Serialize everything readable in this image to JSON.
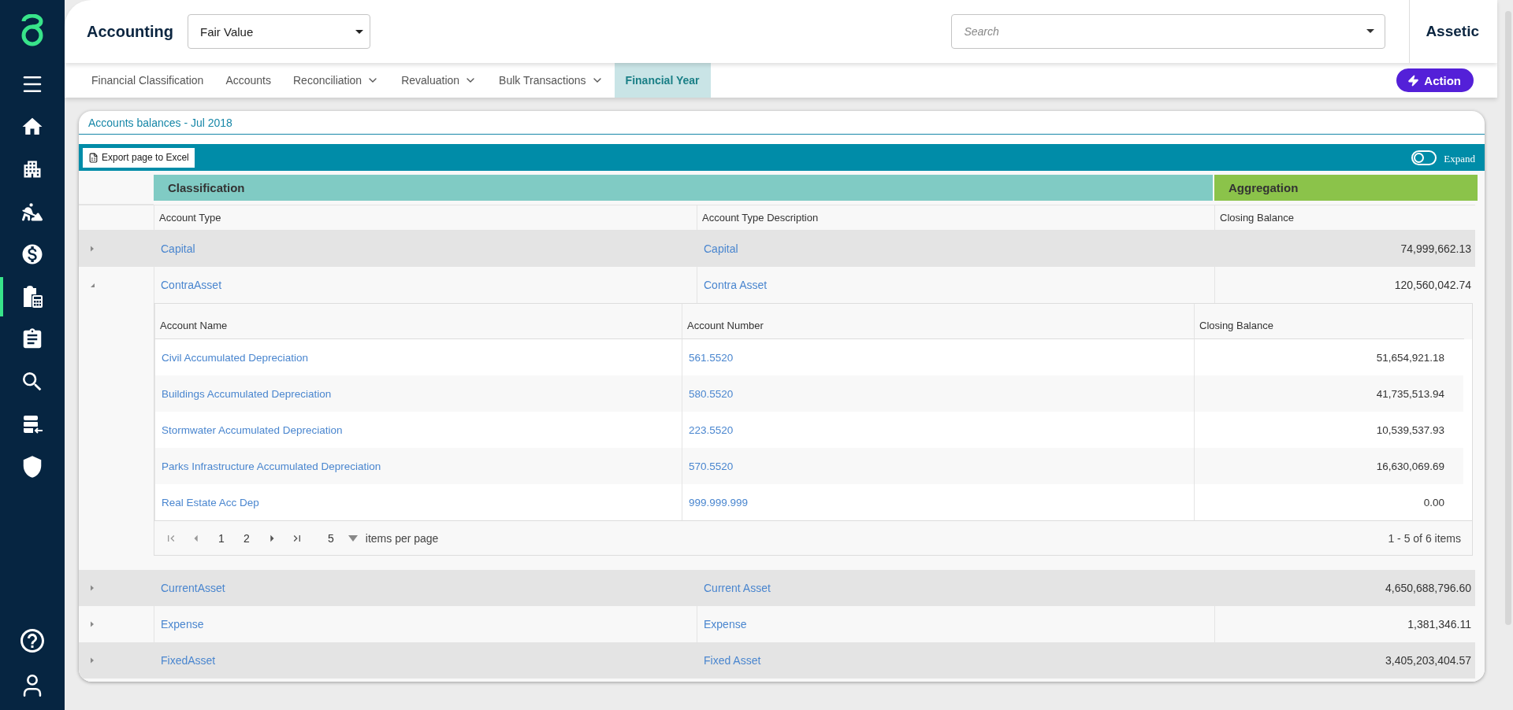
{
  "sidebar": {
    "items": [
      {
        "kind": "menu",
        "selected": false
      },
      {
        "kind": "home",
        "selected": false
      },
      {
        "kind": "building",
        "selected": false
      },
      {
        "kind": "worker",
        "selected": false
      },
      {
        "kind": "finance",
        "selected": false
      },
      {
        "kind": "calculator",
        "selected": true
      },
      {
        "kind": "clipboard",
        "selected": false
      },
      {
        "kind": "search",
        "selected": false
      },
      {
        "kind": "import",
        "selected": false
      },
      {
        "kind": "shield",
        "selected": false
      }
    ],
    "footer_items": [
      {
        "kind": "help"
      },
      {
        "kind": "user"
      }
    ]
  },
  "header": {
    "title": "Accounting",
    "view_select": {
      "value": "Fair Value"
    },
    "search": {
      "placeholder": "Search"
    },
    "brand": "Assetic"
  },
  "tabs": [
    {
      "label": "Financial Classification",
      "selected": false,
      "has_menu": false
    },
    {
      "label": "Accounts",
      "selected": false,
      "has_menu": false
    },
    {
      "label": "Reconciliation",
      "selected": false,
      "has_menu": true
    },
    {
      "label": "Revaluation",
      "selected": false,
      "has_menu": true
    },
    {
      "label": "Bulk Transactions",
      "selected": false,
      "has_menu": true
    },
    {
      "label": "Financial Year",
      "selected": true,
      "has_menu": false
    }
  ],
  "action_button": {
    "label": "Action"
  },
  "panel": {
    "title": "Accounts balances - Jul 2018",
    "export_button": "Export page to Excel",
    "expand_toggle": {
      "label": "Expand",
      "on": false
    },
    "column_groups": [
      {
        "label": "Classification",
        "color": "#80cbc4"
      },
      {
        "label": "Aggregation",
        "color": "#8bc34a"
      }
    ],
    "columns": [
      "Account Type",
      "Account Type Description",
      "Closing Balance"
    ],
    "rows": [
      {
        "account_type": "Capital",
        "description": "Capital",
        "closing_balance": "74,999,662.13",
        "expanded": false
      },
      {
        "account_type": "ContraAsset",
        "description": "Contra Asset",
        "closing_balance": "120,560,042.74",
        "expanded": true,
        "details": {
          "columns": [
            "Account Name",
            "Account Number",
            "Closing Balance"
          ],
          "rows": [
            {
              "name": "Civil Accumulated Depreciation",
              "number": "561.5520",
              "closing_balance": "51,654,921.18"
            },
            {
              "name": "Buildings Accumulated Depreciation",
              "number": "580.5520",
              "closing_balance": "41,735,513.94"
            },
            {
              "name": "Stormwater Accumulated Depreciation",
              "number": "223.5520",
              "closing_balance": "10,539,537.93"
            },
            {
              "name": "Parks Infrastructure Accumulated Depreciation",
              "number": "570.5520",
              "closing_balance": "16,630,069.69"
            },
            {
              "name": "Real Estate Acc Dep",
              "number": "999.999.999",
              "closing_balance": "0.00"
            }
          ],
          "pager": {
            "pages": [
              "1",
              "2"
            ],
            "page_size": "5",
            "page_size_label": "items per page",
            "summary": "1 - 5 of 6 items"
          }
        }
      },
      {
        "account_type": "CurrentAsset",
        "description": "Current Asset",
        "closing_balance": "4,650,688,796.60",
        "expanded": false
      },
      {
        "account_type": "Expense",
        "description": "Expense",
        "closing_balance": "1,381,346.11",
        "expanded": false
      },
      {
        "account_type": "FixedAsset",
        "description": "Fixed Asset",
        "closing_balance": "3,405,203,404.57",
        "expanded": false
      }
    ]
  }
}
